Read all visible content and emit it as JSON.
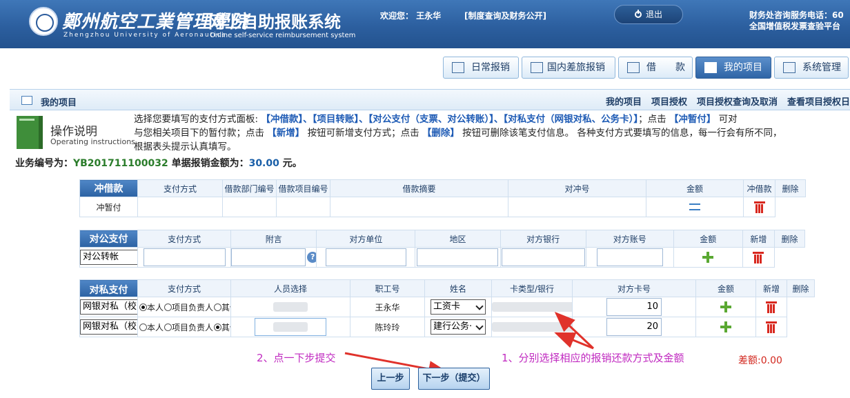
{
  "header": {
    "university_cn": "鄭州航空工業管理學院",
    "university_en": "Zhengzhou University of Aeronautics",
    "system_cn": "网上自助报账系统",
    "system_en": "Online self-service reimbursement system",
    "welcome": "欢迎您： 王永华",
    "notice_link": "[制度查询及财务公开]",
    "logout": "退出",
    "contact_line1": "财务处咨询服务电话：60",
    "contact_line2": "全国增值税发票查验平台"
  },
  "nav": [
    {
      "label": "日常报销"
    },
    {
      "label": "国内差旅报销"
    },
    {
      "label": "借　　款"
    },
    {
      "label": "我的项目"
    },
    {
      "label": "系统管理"
    }
  ],
  "titlebar": {
    "title": "我的项目",
    "links": [
      "我的项目",
      "项目授权",
      "项目授权查询及取消",
      "查看项目授权日"
    ]
  },
  "instructions": {
    "title": "操作说明",
    "subtitle": "Operating instructions",
    "line1_a": "选择您要填写的支付方式面板: ",
    "line1_b": "【冲借款】、【项目转账】、【对公支付（支票、对公转账）】、【对私支付（网银对私、公务卡）】",
    "line1_c": "；点击 ",
    "line1_d": "【冲暂付】",
    "line1_e": " 可对",
    "line2_a": "与您相关项目下的暂付款；点击 ",
    "line2_b": "【新增】",
    "line2_c": " 按钮可新增支付方式；点击 ",
    "line2_d": "【删除】",
    "line2_e": " 按钮可删除该笔支付信息。 各种支付方式要填写的信息，每一行会有所不同，",
    "line3": "根据表头提示认真填写。"
  },
  "business": {
    "label_no": "业务编号为：",
    "no": "YB201711100032",
    "label_amount": " 单据报销金额为：",
    "amount": "30.00",
    "unit": " 元。"
  },
  "loan_section": {
    "title": "冲借款",
    "headers": [
      "支付方式",
      "借款部门编号",
      "借款项目编号",
      "借款摘要",
      "对冲号",
      "金额",
      "冲借款",
      "删除"
    ],
    "row": {
      "method": "冲暂付"
    }
  },
  "public_section": {
    "title": "对公支付",
    "headers": [
      "支付方式",
      "附言",
      "对方单位",
      "地区",
      "对方银行",
      "对方账号",
      "金额",
      "新增",
      "删除"
    ],
    "row": {
      "method": "对公转帐",
      "help": "?"
    }
  },
  "private_section": {
    "title": "对私支付",
    "headers": [
      "支付方式",
      "人员选择",
      "职工号",
      "姓名",
      "卡类型/银行",
      "对方卡号",
      "金额",
      "新增",
      "删除"
    ],
    "radio_labels": [
      "本人",
      "项目负责人",
      "其他人"
    ],
    "rows": [
      {
        "method": "网银对私（校内）",
        "name": "王永华",
        "card_type": "工资卡",
        "amount": "10"
      },
      {
        "method": "网银对私（校内）",
        "name": "陈玲玲",
        "card_type": "建行公务·",
        "amount": "20"
      }
    ]
  },
  "annotations": {
    "note1": "1、分别选择相应的报销还款方式及金额",
    "note2": "2、点一下步提交",
    "diff": "差额:0.00"
  },
  "buttons": {
    "prev": "上一步",
    "next": "下一步（提交）"
  },
  "colors": {
    "header_bg": "#2c5f9f",
    "section_header": "#2c62a3",
    "note": "#c02ac0",
    "arrow": "#e0322b",
    "diff": "#d2261d"
  }
}
